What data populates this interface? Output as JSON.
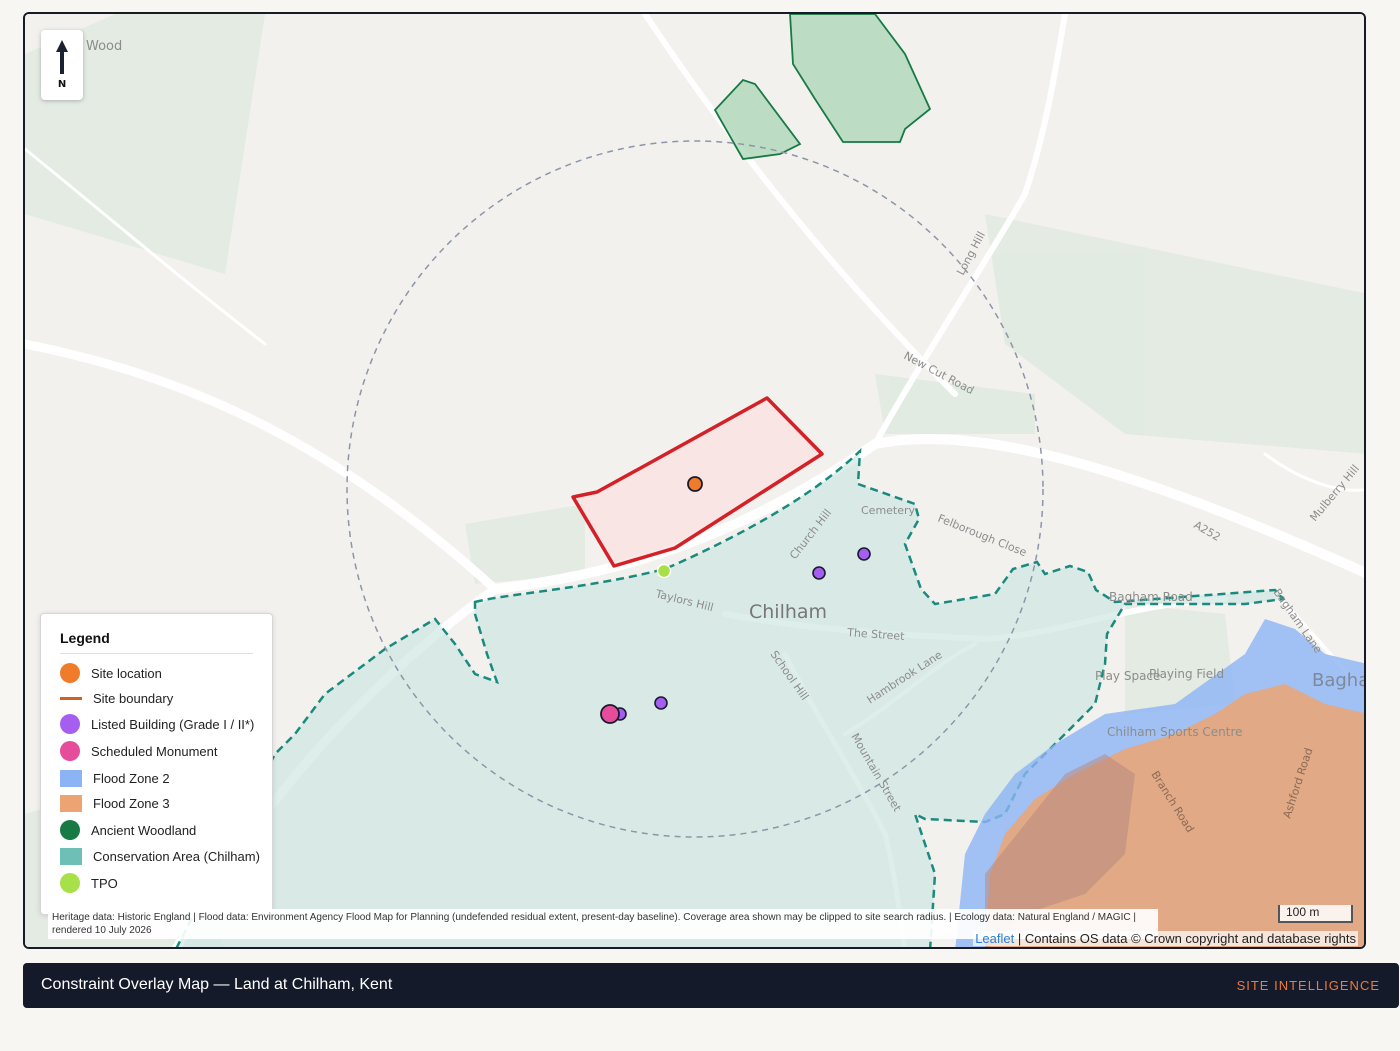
{
  "map": {
    "north_label": "N",
    "place_labels": {
      "wood": "Wood",
      "long_hill": "Long Hill",
      "new_cut_road": "New Cut Road",
      "cemetery": "Cemetery",
      "felborough_close": "Felborough Close",
      "a252": "A252",
      "mulberry_hill": "Mulberry Hill",
      "church_hill": "Church Hill",
      "chilham": "Chilham",
      "taylors_hill": "Taylors Hill",
      "the_street": "The Street",
      "school_hill": "School Hill",
      "hambrook_lane": "Hambrook Lane",
      "mountain_street": "Mountain Street",
      "bagham_road": "Bagham Road",
      "bagham_lane": "Bagham Lane",
      "bagham": "Bagham",
      "playing_field": "Playing Field",
      "play_space": "Play Space",
      "sports_centre": "Chilham Sports Centre",
      "branch_road": "Branch Road",
      "ashford_road": "Ashford Road"
    },
    "colors": {
      "site_location": "#f07c2a",
      "site_boundary": "#d42027",
      "listed_building": "#a55ef0",
      "scheduled_monument": "#e74c9a",
      "flood_zone_2": "#8cb4f4",
      "flood_zone_3": "#eca472",
      "ancient_woodland": "#177a45",
      "conservation_area": "#6ec0b6",
      "tpo": "#a8e04a"
    }
  },
  "legend": {
    "title": "Legend",
    "items": [
      {
        "label": "Site location",
        "icon": "dot",
        "color": "#f07c2a"
      },
      {
        "label": "Site boundary",
        "icon": "line",
        "color": "#d4601a"
      },
      {
        "label": "Listed Building (Grade I / II*)",
        "icon": "dot",
        "color": "#a55ef0"
      },
      {
        "label": "Scheduled Monument",
        "icon": "dot",
        "color": "#e74c9a"
      },
      {
        "label": "Flood Zone 2",
        "icon": "square",
        "color": "#8cb4f4"
      },
      {
        "label": "Flood Zone 3",
        "icon": "square",
        "color": "#eca472"
      },
      {
        "label": "Ancient Woodland",
        "icon": "dot",
        "color": "#177a45"
      },
      {
        "label": "Conservation Area (Chilham)",
        "icon": "square",
        "color": "#6ec0b6"
      },
      {
        "label": "TPO",
        "icon": "dot",
        "color": "#a8e04a"
      }
    ]
  },
  "attribution": "Heritage data: Historic England | Flood data: Environment Agency Flood Map for Planning (undefended residual extent, present-day baseline). Coverage area shown may be clipped to site search radius. | Ecology data: Natural England / MAGIC | rendered 10 July 2026",
  "scale_label": "100 m",
  "copyright": {
    "leaflet": "Leaflet",
    "text": " | Contains OS data © Crown copyright and database rights"
  },
  "footer": {
    "title": "Constraint Overlay Map — Land at Chilham, Kent",
    "brand": "SITE INTELLIGENCE"
  }
}
